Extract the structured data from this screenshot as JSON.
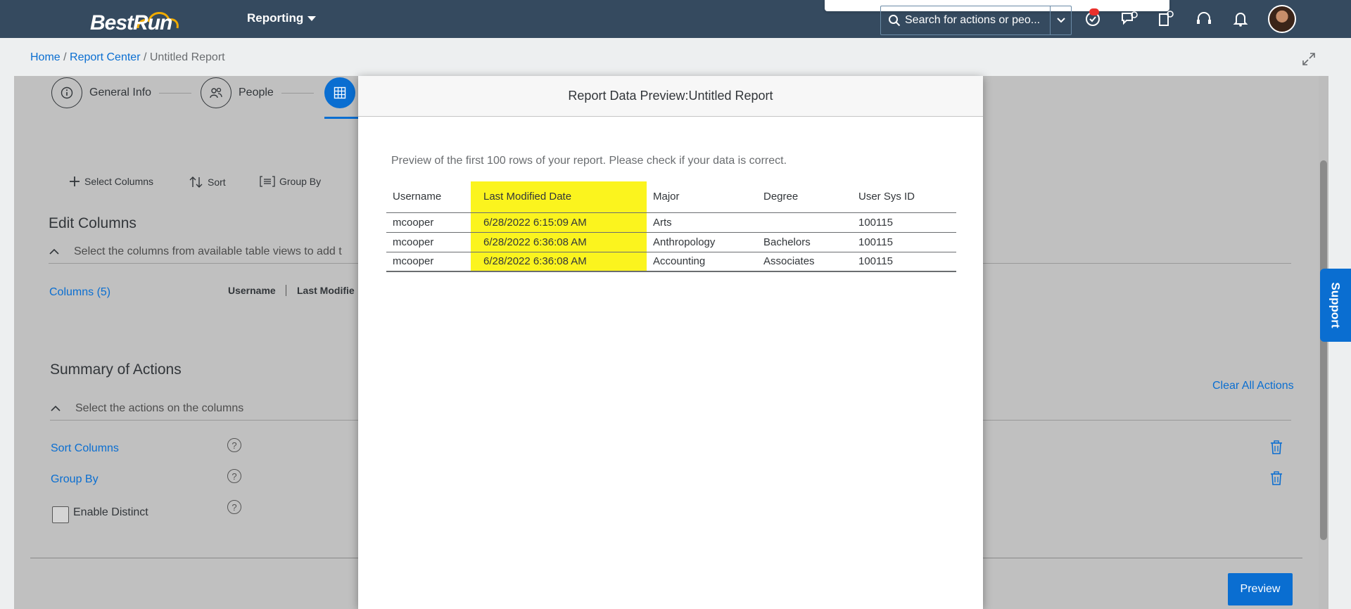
{
  "header": {
    "logo_text": "BestRun",
    "menu_label": "Reporting",
    "search_placeholder": "Search for actions or peo..."
  },
  "breadcrumb": {
    "home": "Home",
    "sep1": " / ",
    "report_center": "Report Center",
    "sep2": " / ",
    "current": "Untitled Report"
  },
  "steps": {
    "general_info": "General Info",
    "people": "People"
  },
  "toolbar": {
    "select_columns": "Select Columns",
    "sort": "Sort",
    "group_by": "Group By"
  },
  "edit_columns": {
    "title": "Edit Columns",
    "subtitle": "Select the columns from available table views to add t",
    "columns_link": "Columns (5)",
    "col_username": "Username",
    "col_last_modified": "Last Modifie"
  },
  "summary": {
    "title": "Summary of Actions",
    "subtitle": "Select the actions on the columns",
    "clear_all": "Clear All Actions",
    "sort_columns": "Sort Columns",
    "group_by": "Group By",
    "enable_distinct": "Enable Distinct",
    "help_glyph": "?"
  },
  "preview_button": "Preview",
  "support_label": "Support",
  "dialog": {
    "title": "Report Data Preview:Untitled Report",
    "description": "Preview of the first 100 rows of your report. Please check if your data is correct.",
    "columns": [
      "Username",
      "Last Modified Date",
      "Major",
      "Degree",
      "User Sys ID"
    ],
    "rows": [
      [
        "mcooper",
        "6/28/2022 6:15:09 AM",
        "Arts",
        "",
        "100115"
      ],
      [
        "mcooper",
        "6/28/2022 6:36:08 AM",
        "Anthropology",
        "Bachelors",
        "100115"
      ],
      [
        "mcooper",
        "6/28/2022 6:36:08 AM",
        "Accounting",
        "Associates",
        "100115"
      ]
    ]
  },
  "colors": {
    "header_bg": "#354a5f",
    "accent": "#0a6ed1",
    "highlight": "#fbf41e"
  }
}
